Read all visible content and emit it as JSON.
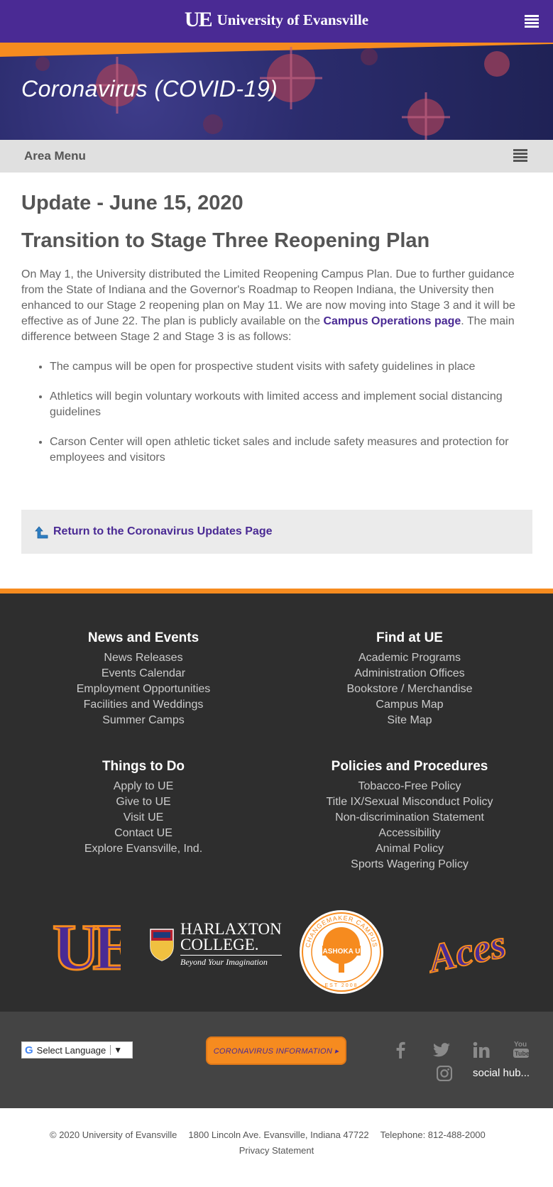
{
  "header": {
    "logo_text": "UE",
    "brand_name": "University of Evansville",
    "menu_icon": "hamburger-menu-icon"
  },
  "hero": {
    "title": "Coronavirus (COVID-19)"
  },
  "area_menu": {
    "label": "Area Menu",
    "icon": "list-menu-icon"
  },
  "article": {
    "update_heading": "Update - June 15, 2020",
    "title": "Transition to Stage Three Reopening Plan",
    "intro_before_link": "On May 1, the University distributed the Limited Reopening Campus Plan. Due to further guidance from the State of Indiana and the Governor's Roadmap to Reopen Indiana, the University then enhanced to our Stage 2 reopening plan on May 11. We are now moving into Stage 3 and it will be effective as of June 22. The plan is publicly available on the ",
    "intro_link": "Campus Operations page",
    "intro_after_link": ". The main difference between Stage 2 and Stage 3 is as follows:",
    "bullets": [
      "The campus will be open for prospective student visits with safety guidelines in place",
      "Athletics will begin voluntary workouts with limited access and implement social distancing guidelines",
      "Carson Center will open athletic ticket sales and include safety measures and protection for employees and visitors"
    ],
    "return_link": "Return to the Coronavirus Updates Page",
    "return_icon": "up-arrow-icon"
  },
  "footer": {
    "news_events": {
      "heading": "News and Events",
      "links": [
        "News Releases",
        "Events Calendar",
        "Employment Opportunities",
        "Facilities and Weddings",
        "Summer Camps"
      ]
    },
    "find_at_ue": {
      "heading": "Find at UE",
      "links": [
        "Academic Programs",
        "Administration Offices",
        "Bookstore / Merchandise",
        "Campus Map",
        "Site Map"
      ]
    },
    "things_to_do": {
      "heading": "Things to Do",
      "links": [
        "Apply to UE",
        "Give to UE",
        "Visit UE",
        "Contact UE",
        "Explore Evansville, Ind."
      ]
    },
    "policies": {
      "heading": "Policies and Procedures",
      "links": [
        "Tobacco-Free Policy",
        "Title IX/Sexual Misconduct Policy",
        "Non-discrimination Statement",
        "Accessibility",
        "Animal Policy",
        "Sports Wagering Policy"
      ]
    },
    "logos": {
      "ue": "UE",
      "harlaxton_name_1": "HARLAXTON",
      "harlaxton_name_2": "COLLEGE.",
      "harlaxton_tagline": "Beyond Your Imagination",
      "ashoka_top": "CHANGEMAKER CAMPUS",
      "ashoka_center": "ASHOKA U",
      "ashoka_bottom": "EST 2008",
      "aces": "Aces"
    }
  },
  "subfooter": {
    "language_select": "Select Language",
    "language_arrow": "▼",
    "google_glyph": "G",
    "covid_button": "CORONAVIRUS INFORMATION ▸",
    "social_icons": [
      "facebook-icon",
      "twitter-icon",
      "linkedin-icon",
      "youtube-icon",
      "instagram-icon"
    ],
    "social_hub": "social hub..."
  },
  "copyright": {
    "copy": "© 2020 University of Evansville",
    "address": "1800 Lincoln Ave. Evansville, Indiana 47722",
    "phone": "Telephone: 812-488-2000",
    "privacy": "Privacy Statement"
  },
  "colors": {
    "brand_purple": "#4a2a94",
    "brand_orange": "#f68b1f",
    "footer_bg": "#2e2e2e"
  }
}
